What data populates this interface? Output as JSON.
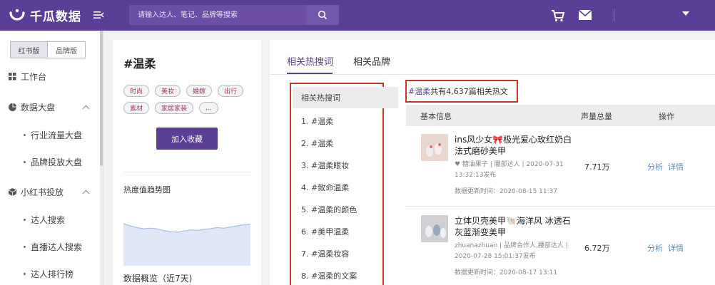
{
  "brand": {
    "name": "千瓜数据"
  },
  "search": {
    "placeholder": "请输入达人、笔记、品牌等搜索"
  },
  "sidebar": {
    "versions": [
      "红书版",
      "品牌版"
    ],
    "items": [
      {
        "label": "工作台",
        "icon": "grid-icon"
      },
      {
        "label": "数据大盘",
        "icon": "pie-chart-icon"
      },
      {
        "label": "行业流量大盘"
      },
      {
        "label": "品牌投放大盘"
      },
      {
        "label": "小红书投放",
        "icon": "box-icon"
      },
      {
        "label": "达人搜索"
      },
      {
        "label": "直播达人搜索"
      },
      {
        "label": "达人排行榜"
      }
    ]
  },
  "topic": {
    "title": "#温柔",
    "tags": [
      "时尚",
      "美妆",
      "婚嫁",
      "出行",
      "素材",
      "家居家装",
      "..."
    ],
    "fav_label": "加入收藏",
    "heat_title": "热度值趋势图",
    "overview_title": "数据概览（近7天)"
  },
  "tabs": [
    "相关热搜词",
    "相关品牌"
  ],
  "search_list": {
    "header": "相关热搜词",
    "items": [
      "1. #温柔",
      "2. #温柔",
      "3. #温柔眼妆",
      "4. #致命温柔",
      "5. #温柔的颜色",
      "6. #美甲温柔",
      "7. #温柔妆容",
      "8. #温柔的文案"
    ]
  },
  "results": {
    "keyword": "#温柔",
    "summary": " 共有4,637篇相关热文",
    "columns": [
      "基本信息",
      "声量总量",
      "操作"
    ],
    "rows": [
      {
        "title": "ins风少女🎀极光爱心玫红奶白法式磨砂美甲",
        "meta": "♥ 糖油果子 | 腰部达人 | 2020-07-31 13:32:13发布",
        "updated": "数据更新时间：2020-08-15 11:37",
        "volume": "7.71万",
        "actions": [
          "分析",
          "详情"
        ]
      },
      {
        "title": "立体贝壳美甲🐚海洋风 冰透石灰蓝渐变美甲",
        "meta": "zhuanazhuan | 品牌合作人,腰部达人 | 2020-07-28 15:01:37发布",
        "updated": "数据更新时间：2020-08-17 13:11",
        "volume": "6.72万",
        "actions": [
          "分析",
          "详情"
        ]
      }
    ]
  },
  "colors": {
    "primary": "#5b3e96",
    "highlight_border": "#c0392b",
    "link": "#5b8bd0"
  },
  "heat_trend": [
    0.62,
    0.58,
    0.55,
    0.53,
    0.54,
    0.53,
    0.5,
    0.48,
    0.47,
    0.49,
    0.51,
    0.5,
    0.52,
    0.53,
    0.55,
    0.54,
    0.56,
    0.58,
    0.6,
    0.61
  ]
}
